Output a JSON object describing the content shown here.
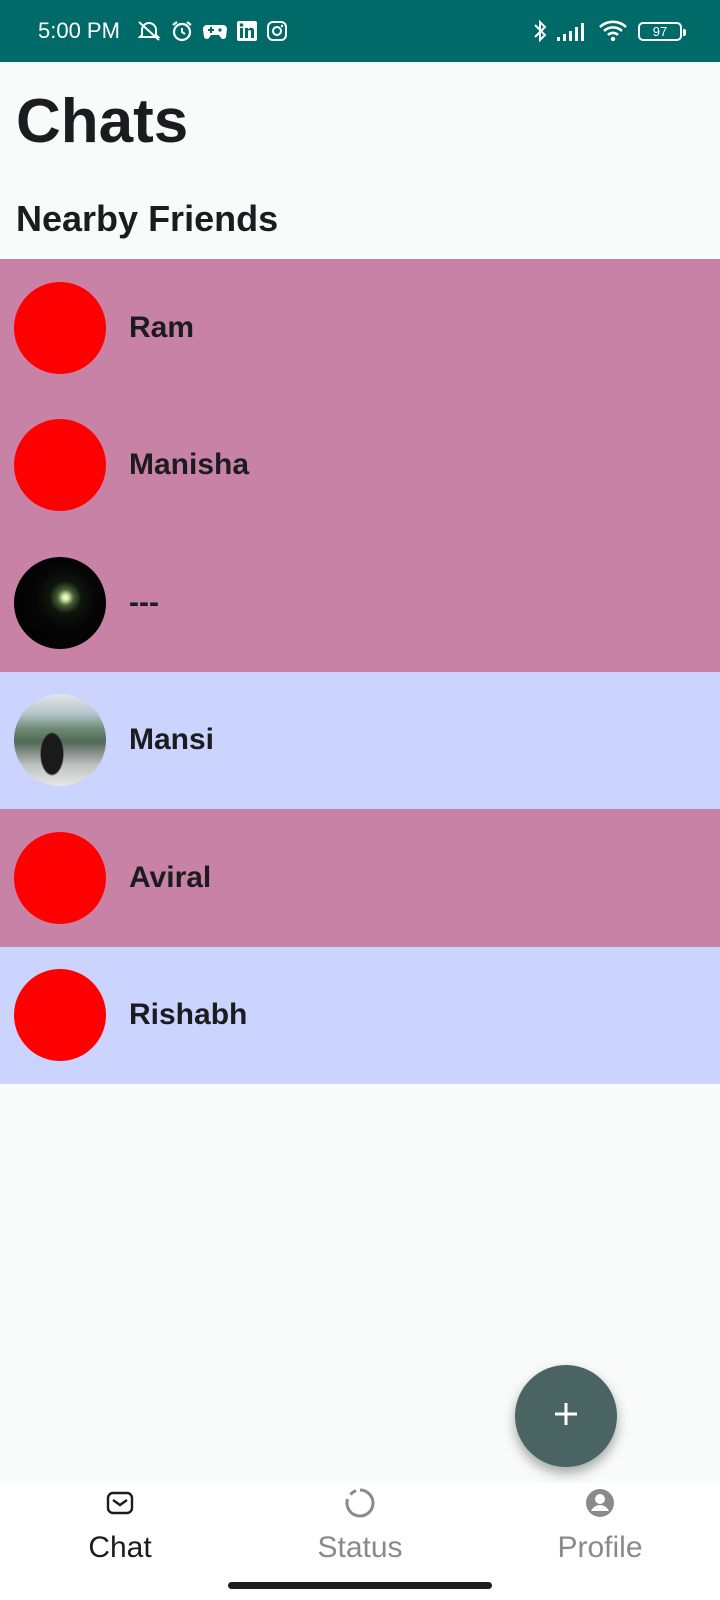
{
  "status_bar": {
    "time": "5:00 PM",
    "battery": "97",
    "icons": [
      "alarm-off-icon",
      "alarm-icon",
      "game-controller-icon",
      "linkedin-icon",
      "instagram-icon",
      "bluetooth-icon",
      "signal-icon",
      "wifi-icon",
      "battery-icon"
    ],
    "background_color": "#006a68"
  },
  "header": {
    "title": "Chats",
    "section_title": "Nearby Friends"
  },
  "friends": [
    {
      "name": "Ram",
      "row_color": "#c882a6",
      "avatar": "red-circle"
    },
    {
      "name": "Manisha",
      "row_color": "#c882a6",
      "avatar": "red-circle"
    },
    {
      "name": "---",
      "row_color": "#c882a6",
      "avatar": "dark-photo"
    },
    {
      "name": "Mansi",
      "row_color": "#cbd3ff",
      "avatar": "landscape-photo"
    },
    {
      "name": "Aviral",
      "row_color": "#c882a6",
      "avatar": "red-circle"
    },
    {
      "name": "Rishabh",
      "row_color": "#cbd3ff",
      "avatar": "red-circle"
    }
  ],
  "fab": {
    "icon": "plus-icon",
    "color": "#4a6363"
  },
  "bottom_nav": {
    "items": [
      {
        "label": "Chat",
        "icon": "chat-icon",
        "active": true
      },
      {
        "label": "Status",
        "icon": "status-icon",
        "active": false
      },
      {
        "label": "Profile",
        "icon": "profile-icon",
        "active": false
      }
    ]
  }
}
